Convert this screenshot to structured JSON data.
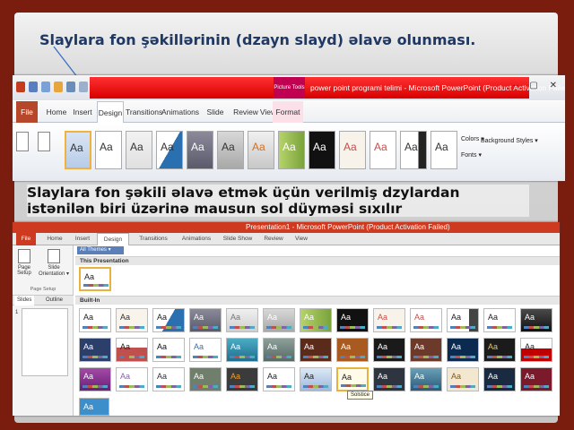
{
  "slide": {
    "title": "Slaylara fon şəkillərinin (dzayn slayd) əlavə olunması.",
    "caption": "Slaylara fon şəkili əlavə etmək üçün verilmiş dzylardan istənilən biri üzərinə mausun sol düyməsi sıxılır"
  },
  "shot1": {
    "contextual_tab": "Picture Tools",
    "window_title": "power point programi telimi - Microsoft PowerPoint (Product Activation Failed)",
    "window_buttons": "– ▢ ✕",
    "tabs": [
      {
        "label": "File"
      },
      {
        "label": "Home"
      },
      {
        "label": "Insert"
      },
      {
        "label": "Design"
      },
      {
        "label": "Transitions"
      },
      {
        "label": "Animations"
      },
      {
        "label": "Slide Show"
      },
      {
        "label": "Review"
      },
      {
        "label": "View"
      },
      {
        "label": "Format"
      }
    ],
    "theme_label": "Aa",
    "colors_label": "Colors ▾",
    "fonts_label": "Fonts ▾",
    "background_styles_label": "Background Styles ▾"
  },
  "shot2": {
    "window_title": "Presentation1 - Microsoft PowerPoint (Product Activation Failed)",
    "tabs": [
      {
        "label": "File"
      },
      {
        "label": "Home"
      },
      {
        "label": "Insert"
      },
      {
        "label": "Design"
      },
      {
        "label": "Transitions"
      },
      {
        "label": "Animations"
      },
      {
        "label": "Slide Show"
      },
      {
        "label": "Review"
      },
      {
        "label": "View"
      }
    ],
    "page_setup_label": "Page Setup",
    "slide_orientation_label": "Slide Orientation ▾",
    "group_label": "Page Setup",
    "pane_tabs": [
      "Slides",
      "Outline"
    ],
    "slide_number": "1",
    "all_themes_label": "All Themes ▾",
    "this_presentation_label": "This Presentation",
    "built_in_label": "Built-In",
    "theme_label": "Aa",
    "tooltip": "Solstice"
  },
  "colors": {
    "background": "#7a1d0f",
    "title": "#1f3864",
    "powerpoint_red": "#d80000",
    "selected_border": "#e8b33c"
  }
}
